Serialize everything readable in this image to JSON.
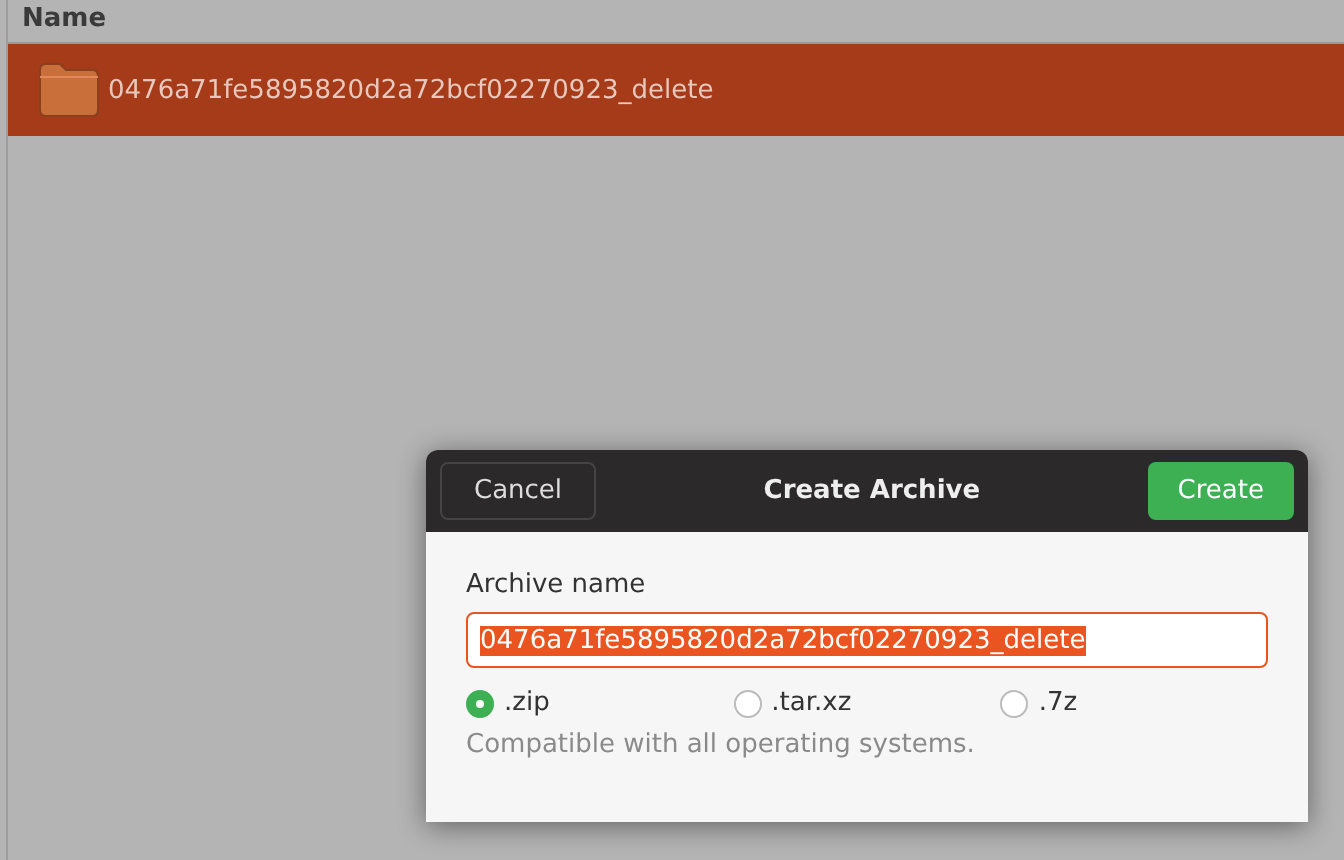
{
  "file_list": {
    "column_header": "Name",
    "rows": [
      {
        "name": "0476a71fe5895820d2a72bcf02270923_delete",
        "selected": true
      }
    ]
  },
  "dialog": {
    "title": "Create Archive",
    "cancel_button": "Cancel",
    "create_button": "Create",
    "name_label": "Archive name",
    "name_value": "0476a71fe5895820d2a72bcf02270923_delete",
    "name_text_selected": true,
    "formats": [
      {
        "label": ".zip",
        "selected": true
      },
      {
        "label": ".tar.xz",
        "selected": false
      },
      {
        "label": ".7z",
        "selected": false
      }
    ],
    "description": "Compatible with all operating systems."
  }
}
